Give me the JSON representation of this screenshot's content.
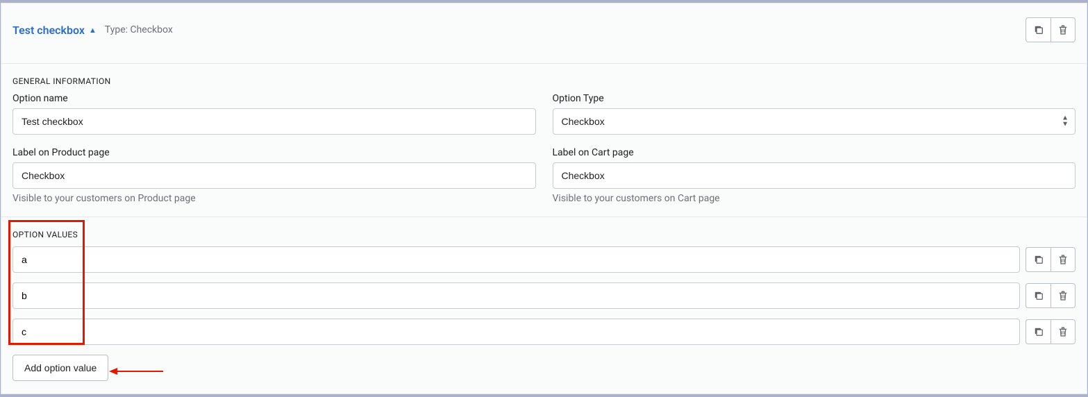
{
  "header": {
    "title": "Test checkbox",
    "type_label": "Type: Checkbox"
  },
  "general": {
    "heading": "GENERAL INFORMATION",
    "option_name_label": "Option name",
    "option_name_value": "Test checkbox",
    "option_type_label": "Option Type",
    "option_type_value": "Checkbox",
    "label_product_label": "Label on Product page",
    "label_product_value": "Checkbox",
    "label_product_help": "Visible to your customers on Product page",
    "label_cart_label": "Label on Cart page",
    "label_cart_value": "Checkbox",
    "label_cart_help": "Visible to your customers on Cart page"
  },
  "values": {
    "heading": "OPTION VALUES",
    "items": [
      {
        "value": "a"
      },
      {
        "value": "b"
      },
      {
        "value": "c"
      }
    ],
    "add_label": "Add option value"
  }
}
